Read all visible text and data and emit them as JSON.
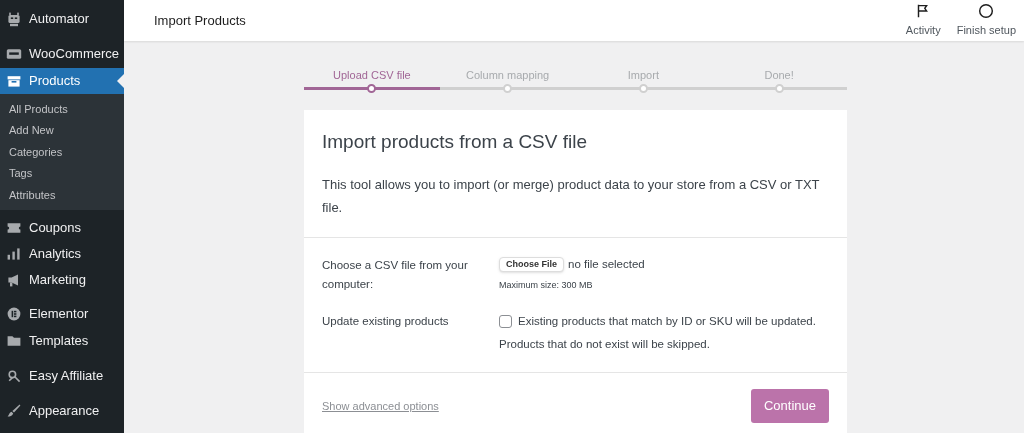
{
  "sidebar": {
    "items": [
      {
        "label": "Automator",
        "kind": "robot",
        "selected": false
      },
      {
        "label": "WooCommerce",
        "kind": "woo",
        "selected": false
      },
      {
        "label": "Products",
        "kind": "box",
        "selected": true,
        "children": [
          {
            "label": "All Products"
          },
          {
            "label": "Add New"
          },
          {
            "label": "Categories"
          },
          {
            "label": "Tags"
          },
          {
            "label": "Attributes"
          }
        ]
      },
      {
        "label": "Coupons",
        "kind": "ticket",
        "selected": false
      },
      {
        "label": "Analytics",
        "kind": "bars",
        "selected": false
      },
      {
        "label": "Marketing",
        "kind": "megaphone",
        "selected": false
      },
      {
        "label": "Elementor",
        "kind": "elementor",
        "selected": false
      },
      {
        "label": "Templates",
        "kind": "folder",
        "selected": false
      },
      {
        "label": "Easy Affiliate",
        "kind": "affiliate",
        "selected": false
      },
      {
        "label": "Appearance",
        "kind": "brush",
        "selected": false
      }
    ]
  },
  "header": {
    "title": "Import Products",
    "actions": [
      {
        "label": "Activity",
        "kind": "flag"
      },
      {
        "label": "Finish setup",
        "kind": "circle"
      }
    ]
  },
  "steps": [
    {
      "label": "Upload CSV file",
      "selected": true
    },
    {
      "label": "Column mapping",
      "selected": false
    },
    {
      "label": "Import",
      "selected": false
    },
    {
      "label": "Done!",
      "selected": false
    }
  ],
  "card": {
    "title": "Import products from a CSV file",
    "description": "This tool allows you to import (or merge) product data to your store from a CSV or TXT file.",
    "file_row": {
      "label": "Choose a CSV file from your computer:",
      "button": "Choose File",
      "status": "no file selected",
      "hint": "Maximum size: 300 MB"
    },
    "update_row": {
      "label": "Update existing products",
      "checked": false,
      "text": "Existing products that match by ID or SKU will be updated.",
      "note": "Products that do not exist will be skipped."
    },
    "advanced_link": "Show advanced options",
    "continue_button": "Continue"
  }
}
